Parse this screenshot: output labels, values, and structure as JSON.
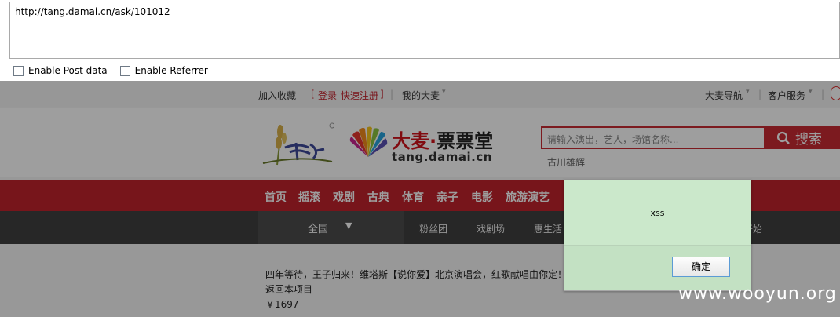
{
  "hackbar": {
    "url": "http://tang.damai.cn/ask/101012",
    "enable_post": "Enable Post data",
    "enable_referrer": "Enable Referrer"
  },
  "site": {
    "topbar": {
      "favorite": "加入收藏",
      "bracket_open": "[",
      "login": "登录",
      "register": "快速注册",
      "bracket_close": "]",
      "my_damai": "我的大麦",
      "nav": "大麦导航",
      "service": "客户服务"
    },
    "brand": {
      "cn_red": "大麦·",
      "cn_black": "票票堂",
      "en": "tang.damai.cn"
    },
    "search": {
      "placeholder": "请输入演出，艺人，场馆名称...",
      "button": "搜索",
      "hot": "古川雄辉"
    },
    "nav_red": [
      "首页",
      "摇滚",
      "戏剧",
      "古典",
      "体育",
      "亲子",
      "电影",
      "旅游演艺"
    ],
    "nav_dark": {
      "all": "全国",
      "items": [
        "粉丝团",
        "戏剧场",
        "惠生活",
        "开始"
      ]
    },
    "content": {
      "title": "四年等待，王子归来！维塔斯【说你爱】北京演唱会，红歌献唱由你定！",
      "back": "返回本项目",
      "price": "￥1697"
    }
  },
  "dialog": {
    "message": "xss",
    "ok": "确定"
  },
  "watermark": "www.wooyun.org",
  "colors": {
    "brand_red": "#c0232d",
    "dialog_bg": "#cbe8cb"
  }
}
